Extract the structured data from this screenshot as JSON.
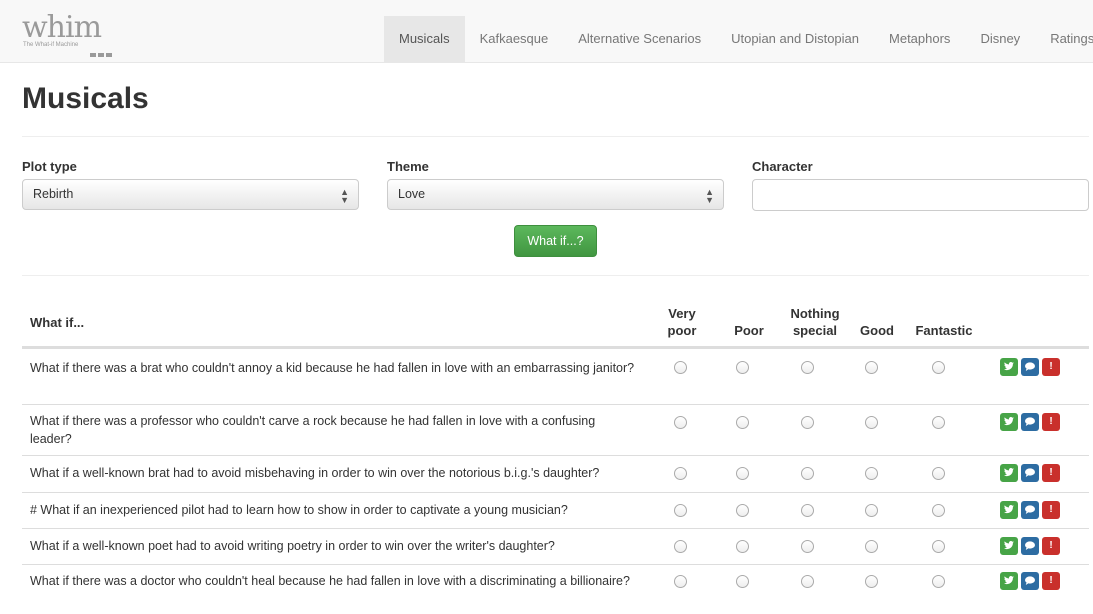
{
  "brand": {
    "logo_text": "whim",
    "logo_subtext": "The What-if Machine"
  },
  "nav": {
    "items": [
      "Musicals",
      "Kafkaesque",
      "Alternative Scenarios",
      "Utopian and Distopian",
      "Metaphors",
      "Disney",
      "Ratings"
    ],
    "active": "Musicals"
  },
  "page": {
    "title": "Musicals"
  },
  "form": {
    "plot_type_label": "Plot type",
    "plot_type_value": "Rebirth",
    "theme_label": "Theme",
    "theme_value": "Love",
    "character_label": "Character",
    "character_value": "",
    "submit_label": "What if...?"
  },
  "table": {
    "headers": {
      "what_if": "What if...",
      "very_poor_1": "Very",
      "very_poor_2": "poor",
      "poor": "Poor",
      "nothing_special_1": "Nothing",
      "nothing_special_2": "special",
      "good": "Good",
      "fantastic": "Fantastic"
    },
    "rows": [
      "What if there was a brat who couldn't annoy a kid because he had fallen in love with an embarrassing janitor?",
      "What if there was a professor who couldn't carve a rock because he had fallen in love with a confusing leader?",
      "What if a well-known brat had to avoid misbehaving in order to win over the notorious b.i.g.'s daughter?",
      "# What if an inexperienced pilot had to learn how to show in order to captivate a young musician?",
      "What if a well-known poet had to avoid writing poetry in order to win over the writer's daughter?",
      "What if there was a doctor who couldn't heal because he had fallen in love with a discriminating a billionaire?"
    ]
  },
  "icons": {
    "tweet": "twitter-icon",
    "comment": "comment-icon",
    "report": "exclamation-icon"
  },
  "colors": {
    "tweet": "#47a447",
    "comment": "#2d6ca2",
    "report": "#c9302c",
    "submit": "#5cb85c"
  }
}
